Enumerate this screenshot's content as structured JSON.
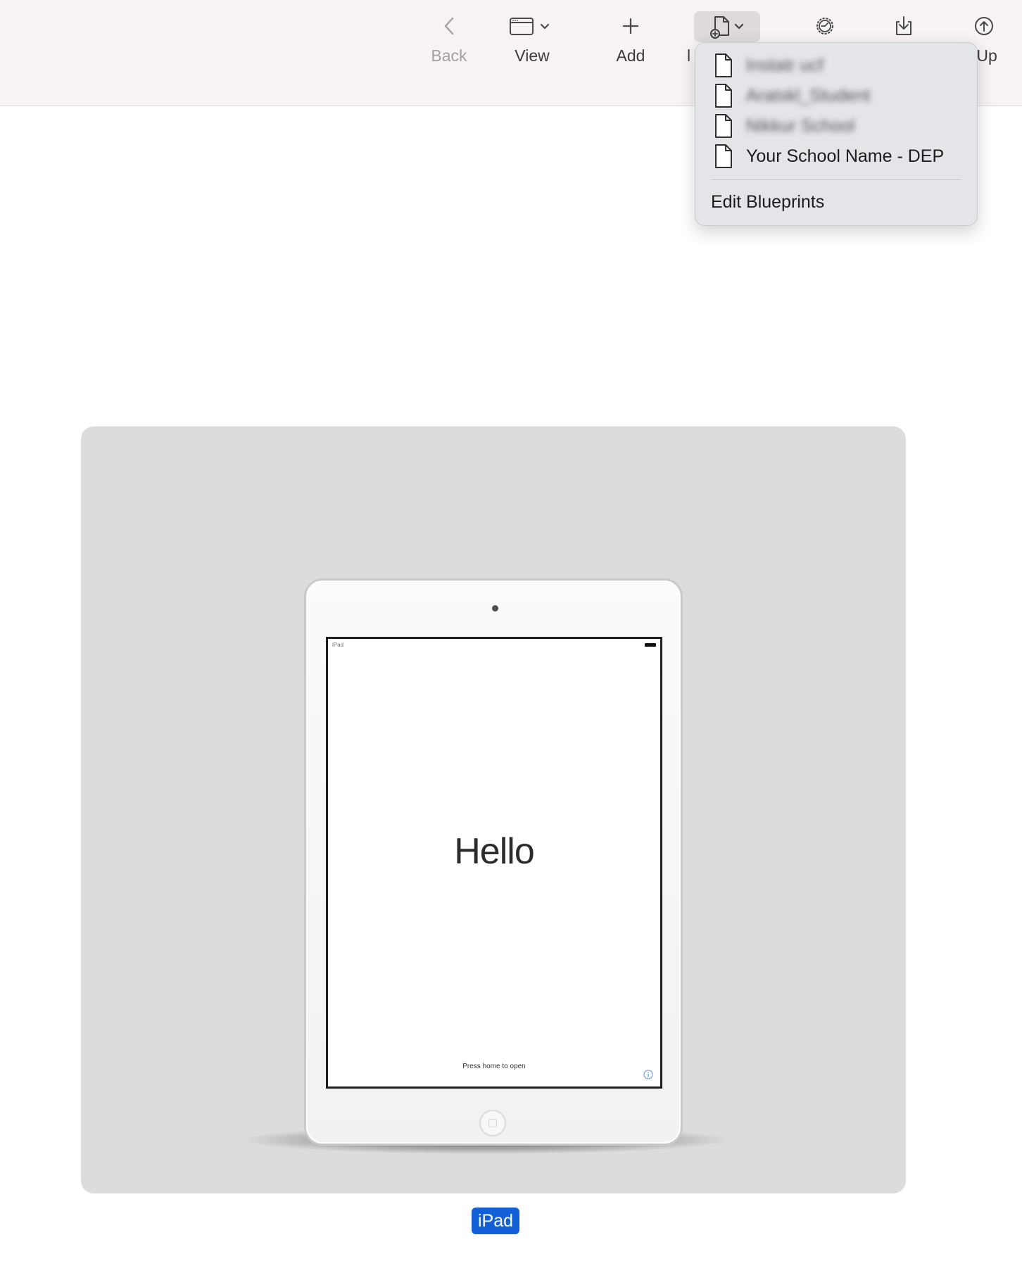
{
  "toolbar": {
    "back_label": "Back",
    "view_label": "View",
    "add_label": "Add",
    "apply_partial_label": "l",
    "backup_partial_label": "ck Up"
  },
  "icons": {
    "back": "chevron-left-icon",
    "view": "window-icon",
    "add": "plus-icon",
    "blueprint": "document-add-icon",
    "settings": "gear-icon",
    "export": "download-tray-icon",
    "backup": "upload-circle-icon",
    "menu_item": "document-icon"
  },
  "blueprints_menu": {
    "items": [
      {
        "label": "Instatr ucf",
        "redacted": true
      },
      {
        "label": "Aratskl_Student",
        "redacted": true
      },
      {
        "label": "Nikkur School",
        "redacted": true
      },
      {
        "label": "Your School Name - DEP",
        "redacted": false
      }
    ],
    "edit_label": "Edit Blueprints"
  },
  "device": {
    "screen_status": "iPad",
    "screen_greeting": "Hello",
    "screen_hint": "Press home to open",
    "name": "iPad"
  },
  "colors": {
    "toolbar_bg": "#f7f3f4",
    "menu_bg": "#e3e5e8",
    "tile_bg": "#dcdcdc",
    "selection_accent": "#1360d6"
  }
}
